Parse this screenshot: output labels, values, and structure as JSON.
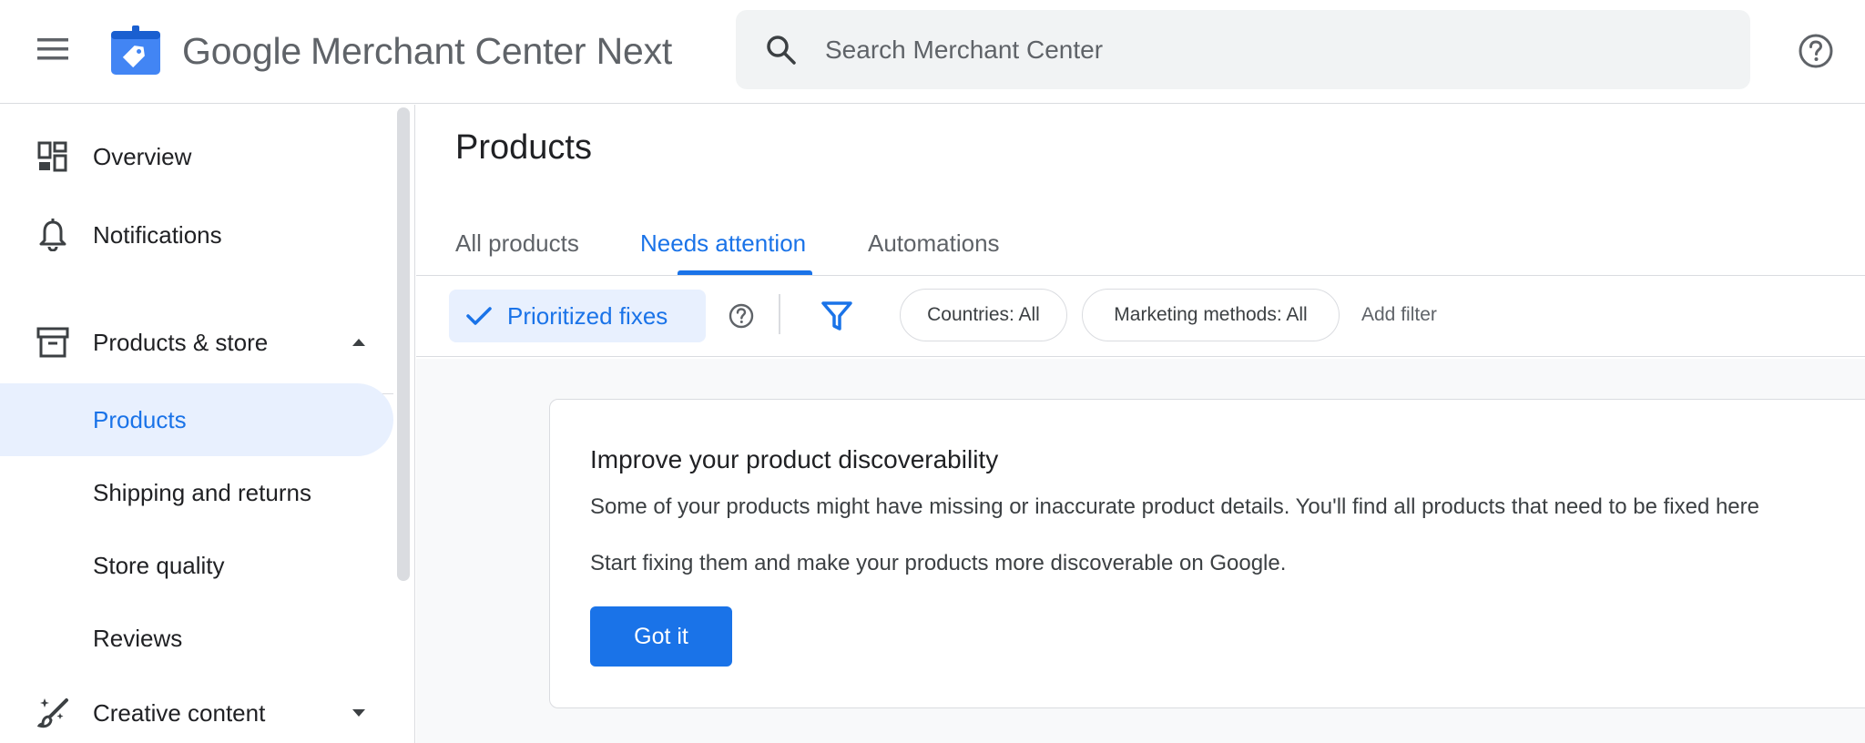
{
  "header": {
    "brand_google": "Google",
    "brand_product": "Merchant Center Next",
    "search_placeholder": "Search Merchant Center",
    "icons": [
      "menu-icon",
      "merchant-center-logo",
      "search-icon",
      "help-icon"
    ]
  },
  "sidebar": {
    "items": [
      {
        "label": "Overview",
        "icon": "dashboard-icon"
      },
      {
        "label": "Notifications",
        "icon": "bell-icon"
      },
      {
        "label": "Products & store",
        "icon": "store-archive-icon",
        "expanded": true
      },
      {
        "label": "Products",
        "active": true
      },
      {
        "label": "Shipping and returns"
      },
      {
        "label": "Store quality"
      },
      {
        "label": "Reviews"
      },
      {
        "label": "Creative content",
        "icon": "magic-brush-icon",
        "expanded": false
      }
    ]
  },
  "main": {
    "title": "Products",
    "tabs": [
      {
        "label": "All products"
      },
      {
        "label": "Needs attention",
        "active": true
      },
      {
        "label": "Automations"
      }
    ],
    "filters": {
      "prioritized": "Prioritized fixes",
      "countries": "Countries: All",
      "marketing": "Marketing methods: All",
      "add_filter": "Add filter"
    },
    "card": {
      "title": "Improve your product discoverability",
      "body1": "Some of your products might have missing or inaccurate product details. You'll find all products that need to be fixed here",
      "body2": "Start fixing them and make your products more discoverable on Google.",
      "button": "Got it"
    }
  },
  "colors": {
    "accent": "#1a73e8",
    "active_bg": "#e8f0fe",
    "text": "#202124",
    "muted": "#5f6368",
    "border": "#dadce0"
  }
}
